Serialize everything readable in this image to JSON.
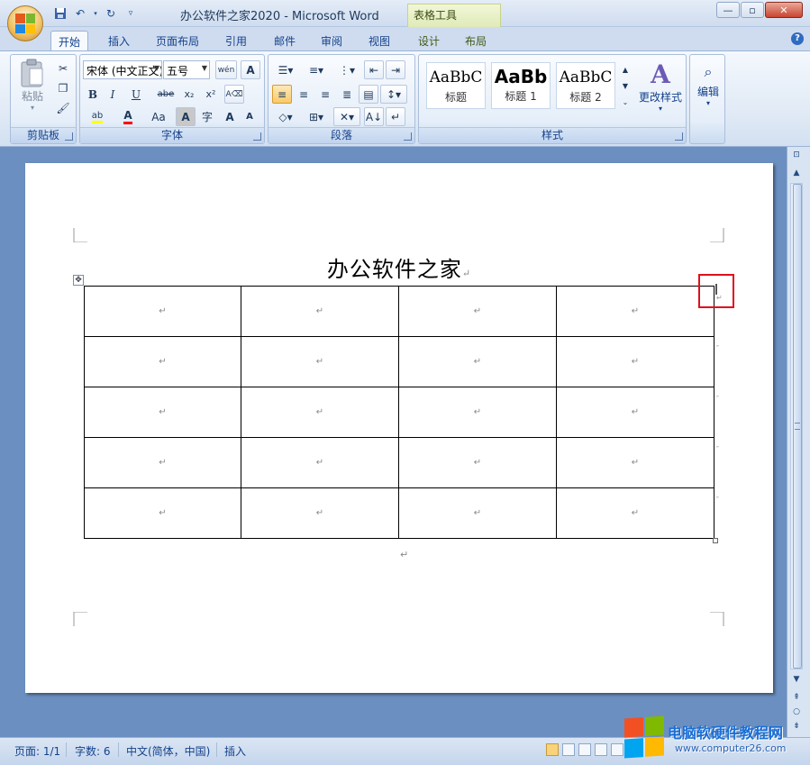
{
  "window": {
    "title": "办公软件之家2020 - Microsoft Word",
    "contextual_tools": "表格工具"
  },
  "tabs": [
    "开始",
    "插入",
    "页面布局",
    "引用",
    "邮件",
    "审阅",
    "视图",
    "设计",
    "布局"
  ],
  "ribbon": {
    "clipboard": {
      "label": "剪贴板",
      "paste": "粘贴"
    },
    "font": {
      "label": "字体",
      "font_name": "宋体 (中文正文)",
      "font_size": "五号",
      "bold": "B",
      "italic": "I",
      "underline": "U",
      "strike": "abe",
      "subscript": "x₂",
      "superscript": "x²",
      "font_color": "A",
      "change_case": "Aa",
      "grow": "A",
      "shrink": "A",
      "char_border": "A",
      "phonetic": "wén",
      "enclose": "字"
    },
    "paragraph": {
      "label": "段落"
    },
    "styles": {
      "label": "样式",
      "items": [
        {
          "sample": "AaBbC",
          "name": "标题"
        },
        {
          "sample": "AaBb",
          "name": "标题 1"
        },
        {
          "sample": "AaBbC",
          "name": "标题 2"
        }
      ],
      "change_styles": "更改样式"
    },
    "editing": {
      "label": "编辑"
    }
  },
  "document": {
    "heading": "办公软件之家",
    "paragraph_mark": "↵",
    "table": {
      "rows": 5,
      "cols": 4
    }
  },
  "status": {
    "page": "页面: 1/1",
    "words": "字数: 6",
    "language": "中文(简体，中国)",
    "mode": "插入"
  },
  "watermark": {
    "title": "电脑软硬件教程网",
    "url": "www.computer26.com"
  },
  "colors": {
    "accent_red": "#e0101b",
    "font_color_bar": "#ff0000",
    "highlight_bar": "#ffff00"
  }
}
